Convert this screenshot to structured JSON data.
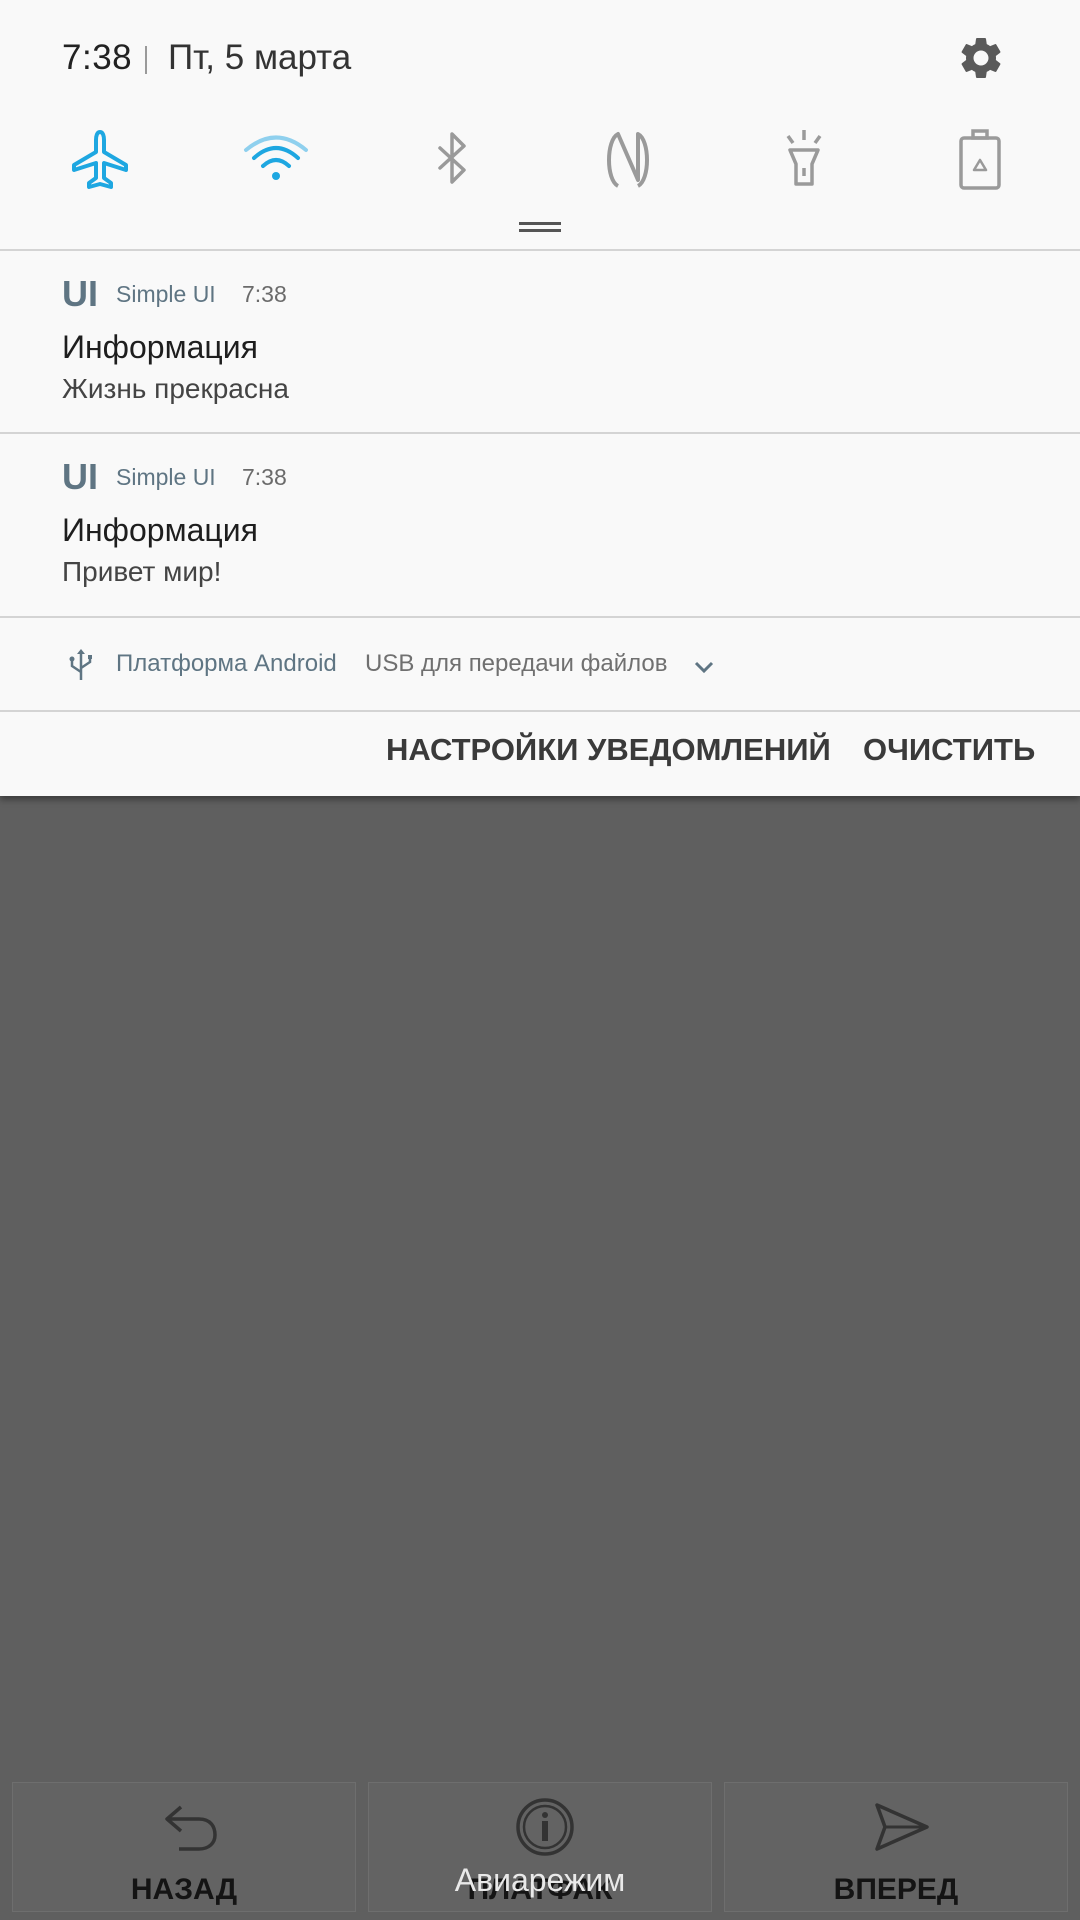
{
  "status": {
    "time": "7:38",
    "date": "Пт, 5 марта"
  },
  "quick_settings": {
    "accent_color": "#1ea7e1",
    "toggles": [
      {
        "icon": "airplane-icon",
        "state": "on"
      },
      {
        "icon": "wifi-icon",
        "state": "on"
      },
      {
        "icon": "bluetooth-icon",
        "state": "off"
      },
      {
        "icon": "nfc-icon",
        "state": "off"
      },
      {
        "icon": "flashlight-icon",
        "state": "off"
      },
      {
        "icon": "power-saving-icon",
        "state": "off"
      }
    ]
  },
  "notifications": [
    {
      "app_logo": "UI",
      "app_name": "Simple UI",
      "time": "7:38",
      "title": "Информация",
      "body": "Жизнь прекрасна"
    },
    {
      "app_logo": "UI",
      "app_name": "Simple UI",
      "time": "7:38",
      "title": "Информация",
      "body": "Привет мир!"
    }
  ],
  "usb": {
    "platform": "Платформа Android",
    "mode": "USB для передачи файлов"
  },
  "actions": {
    "settings": "НАСТРОЙКИ УВЕДОМЛЕНИЙ",
    "clear": "ОЧИСТИТЬ"
  },
  "bottom_bar": {
    "back": "НАЗАД",
    "middle": "ПЛАТФАК",
    "forward": "ВПЕРЕД"
  },
  "toast": "Авиарежим"
}
